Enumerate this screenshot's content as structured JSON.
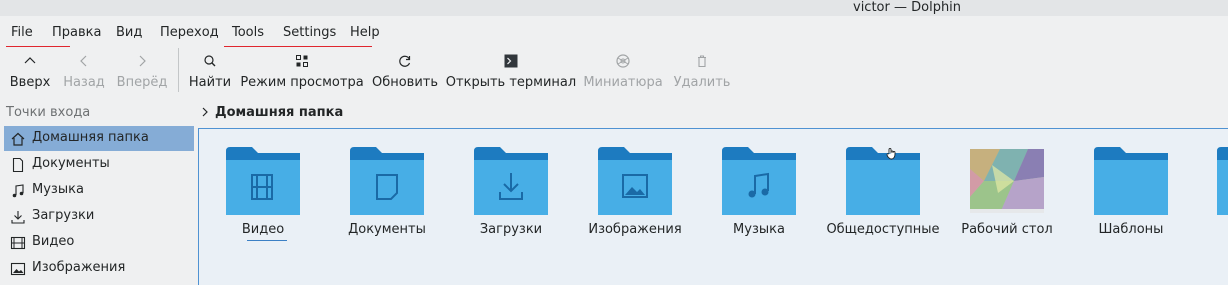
{
  "window": {
    "title": "victor — Dolphin"
  },
  "menu": [
    "File",
    "Правка",
    "Вид",
    "Переход",
    "Tools",
    "Settings",
    "Help"
  ],
  "toolbar": {
    "up": "Вверх",
    "back": "Назад",
    "forward": "Вперёд",
    "find": "Найти",
    "view_mode": "Режим просмотра",
    "reload": "Обновить",
    "terminal": "Открыть терминал",
    "preview": "Миниатюра",
    "delete": "Удалить"
  },
  "sidebar": {
    "header": "Точки входа",
    "items": [
      {
        "label": "Домашняя папка",
        "icon": "home-icon",
        "active": true
      },
      {
        "label": "Документы",
        "icon": "document-icon"
      },
      {
        "label": "Музыка",
        "icon": "music-icon"
      },
      {
        "label": "Загрузки",
        "icon": "download-icon"
      },
      {
        "label": "Видео",
        "icon": "video-icon"
      },
      {
        "label": "Изображения",
        "icon": "image-icon"
      }
    ]
  },
  "breadcrumb": {
    "label": "Домашняя папка"
  },
  "files": [
    {
      "name": "Видео",
      "icon": "folder-video-icon"
    },
    {
      "name": "Документы",
      "icon": "folder-documents-icon"
    },
    {
      "name": "Загрузки",
      "icon": "folder-download-icon"
    },
    {
      "name": "Изображения",
      "icon": "folder-pictures-icon"
    },
    {
      "name": "Музыка",
      "icon": "folder-music-icon"
    },
    {
      "name": "Общедоступные",
      "icon": "folder-public-icon"
    },
    {
      "name": "Рабочий стол",
      "icon": "desktop-thumbnail"
    },
    {
      "name": "Шаблоны",
      "icon": "folder-templates-icon"
    }
  ],
  "colors": {
    "folder_body": "#47aee6",
    "folder_tab": "#1d7bc0",
    "selection": "#85acd6",
    "focus_border": "#4f92d2",
    "menu_underline": "#e0262f"
  }
}
